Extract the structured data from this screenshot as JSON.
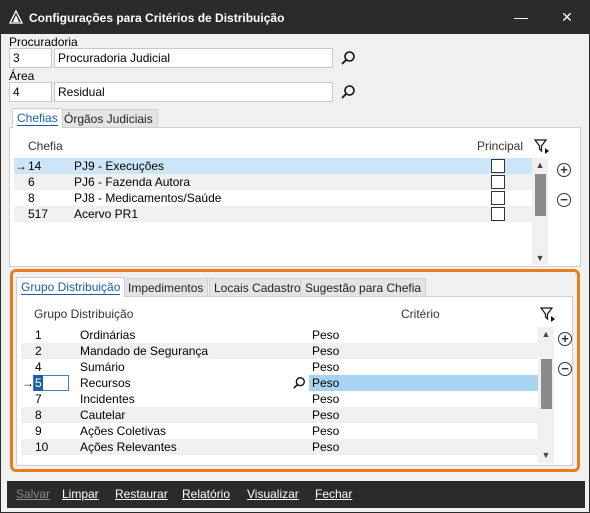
{
  "window": {
    "title": "Configurações para Critérios de Distribuição",
    "minimize": "—",
    "close": "✕"
  },
  "procuradoria": {
    "label": "Procuradoria",
    "code": "3",
    "name": "Procuradoria Judicial"
  },
  "area": {
    "label": "Área",
    "code": "4",
    "name": "Residual"
  },
  "top_tabs": [
    "Chefias",
    "Órgãos Judiciais"
  ],
  "chefias": {
    "col_chefia": "Chefia",
    "col_principal": "Principal",
    "rows": [
      {
        "code": "14",
        "name": "PJ9 - Execuções"
      },
      {
        "code": "6",
        "name": "PJ6 - Fazenda Autora"
      },
      {
        "code": "8",
        "name": "PJ8 - Medicamentos/Saúde"
      },
      {
        "code": "517",
        "name": "Acervo PR1"
      }
    ]
  },
  "bottom_tabs": [
    "Grupo Distribuição",
    "Impedimentos",
    "Locais Cadastro",
    "Sugestão para Chefia"
  ],
  "grupos": {
    "col_grupo": "Grupo Distribuição",
    "col_criterio": "Critério",
    "rows": [
      {
        "code": "1",
        "name": "Ordinárias",
        "criterio": "Peso"
      },
      {
        "code": "2",
        "name": "Mandado de Segurança",
        "criterio": "Peso"
      },
      {
        "code": "4",
        "name": "Sumário",
        "criterio": "Peso"
      },
      {
        "code": "5",
        "name": "Recursos",
        "criterio": "Peso"
      },
      {
        "code": "7",
        "name": "Incidentes",
        "criterio": "Peso"
      },
      {
        "code": "8",
        "name": "Cautelar",
        "criterio": "Peso"
      },
      {
        "code": "9",
        "name": "Ações Coletivas",
        "criterio": "Peso"
      },
      {
        "code": "10",
        "name": "Ações Relevantes",
        "criterio": "Peso"
      }
    ]
  },
  "buttons": {
    "salvar": "Salvar",
    "limpar": "Limpar",
    "restaurar": "Restaurar",
    "relatorio": "Relatório",
    "visualizar": "Visualizar",
    "fechar": "Fechar"
  },
  "colors": {
    "accent": "#1c5fa8",
    "highlight_orange": "#e87d1e",
    "titlebar": "#2b2b2b",
    "selected_row": "#cde6f7"
  }
}
